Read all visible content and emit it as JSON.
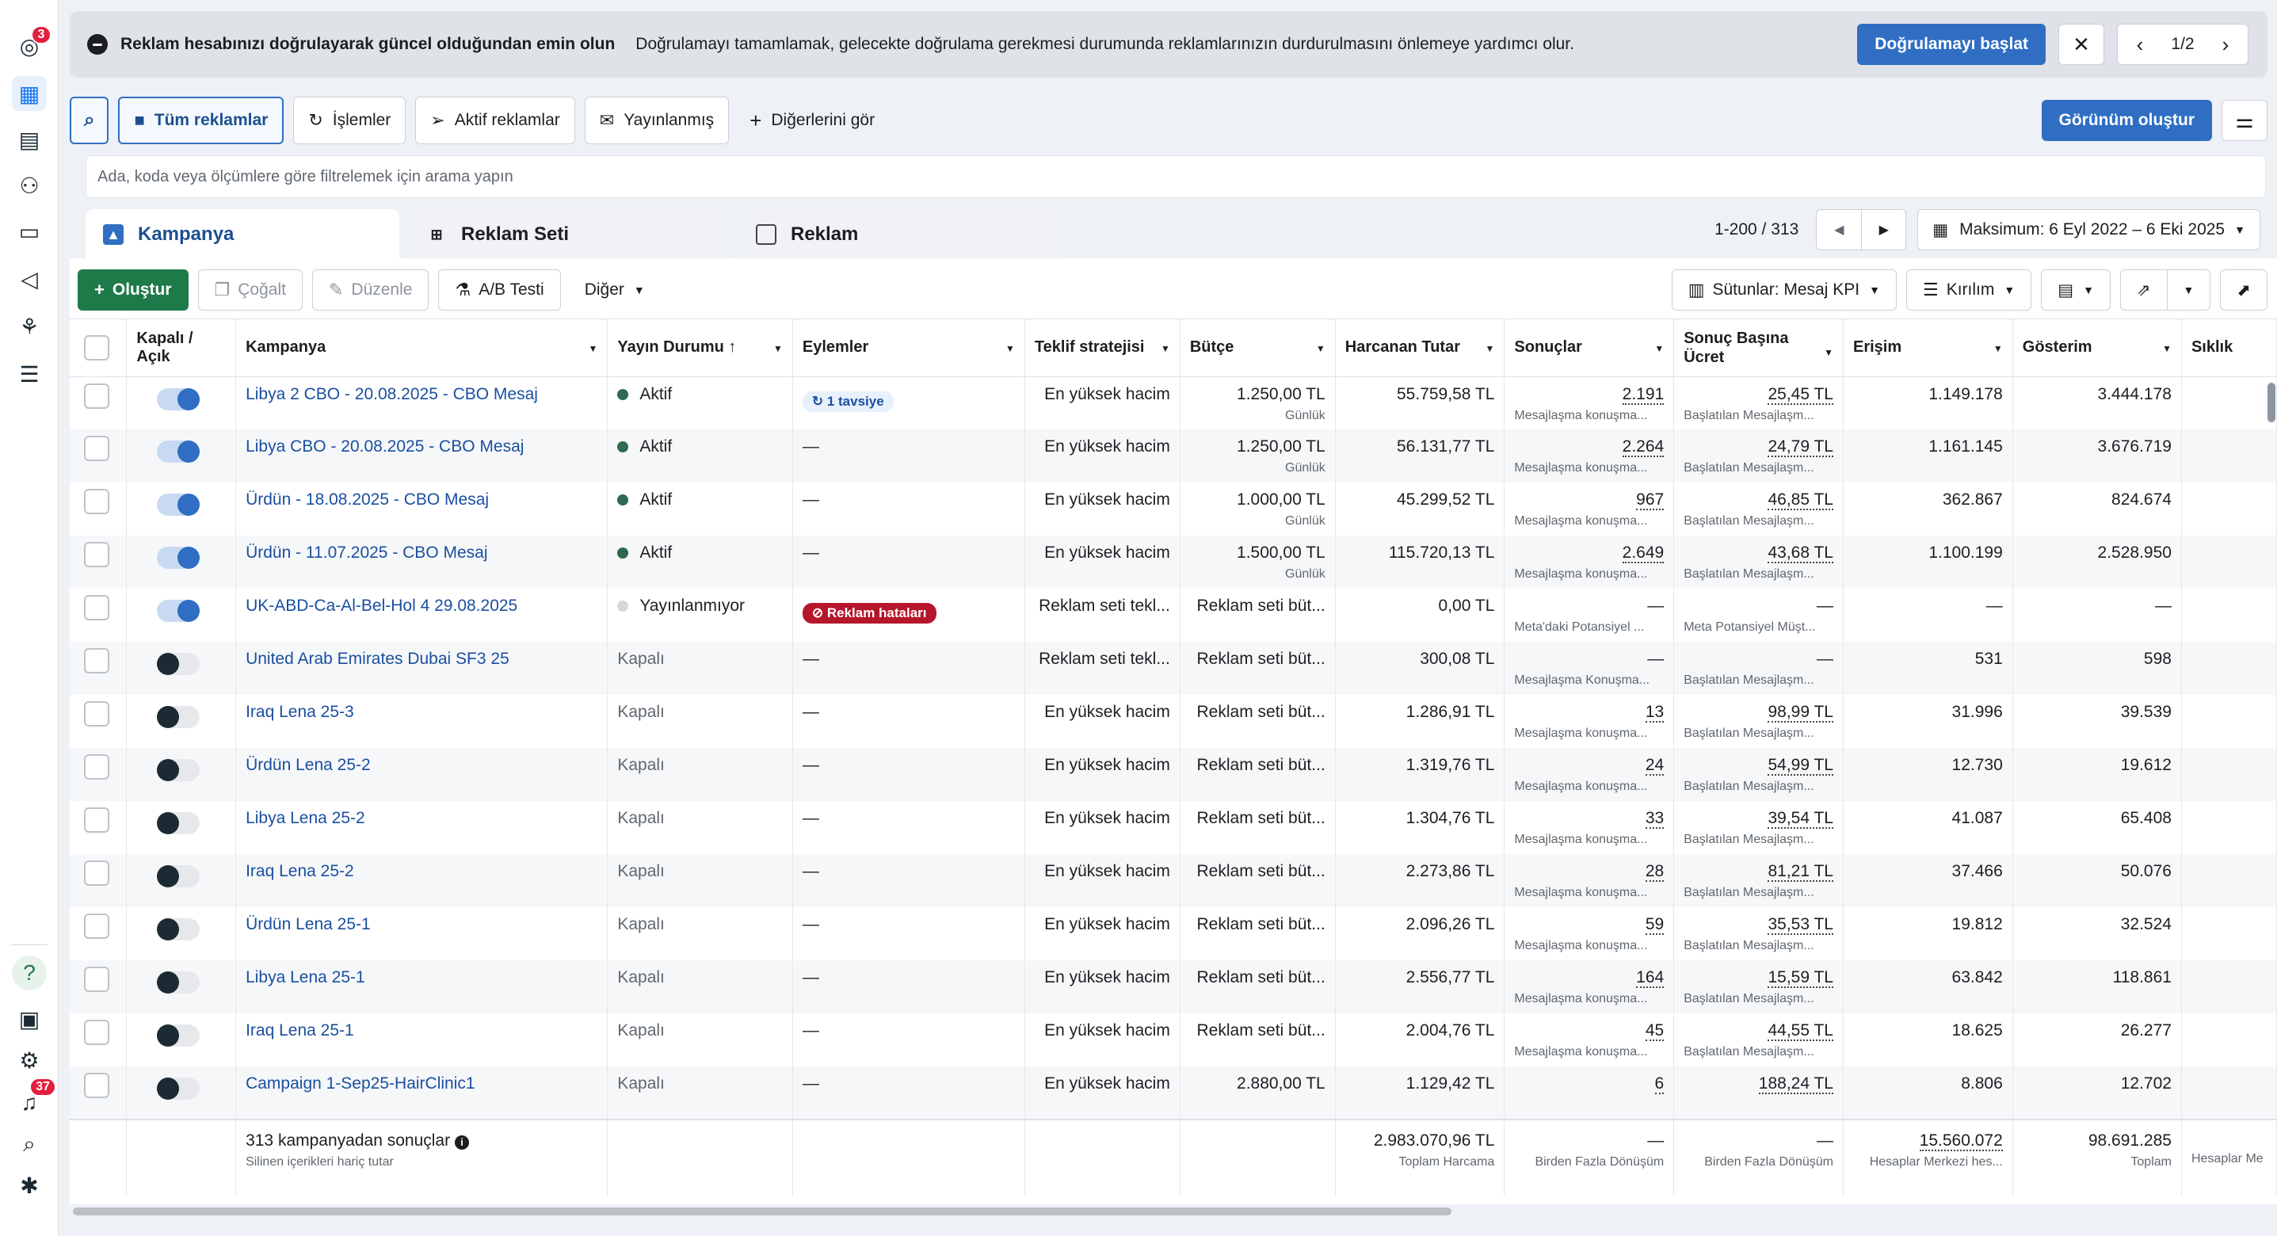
{
  "nav": {
    "top_badge": "3",
    "bottom_badge": "37",
    "items": [
      "account-icon",
      "campaigns-table-icon",
      "pages-icon",
      "audiences-icon",
      "billing-icon",
      "ads-megaphone-icon",
      "structure-icon",
      "menu-icon"
    ],
    "bottom_items": [
      "help-icon",
      "news-icon",
      "settings-icon",
      "notifications-icon",
      "search-icon",
      "bug-icon"
    ]
  },
  "banner": {
    "title": "Reklam hesabınızı doğrulayarak güncel olduğundan emin olun",
    "text": "Doğrulamayı tamamlamak, gelecekte doğrulama gerekmesi durumunda reklamlarınızın durdurulmasını önlemeye yardımcı olur.",
    "cta": "Doğrulamayı başlat",
    "pager": "1/2"
  },
  "toolbar1": {
    "all_ads": "Tüm reklamlar",
    "actions": "İşlemler",
    "active_ads": "Aktif reklamlar",
    "published": "Yayınlanmış",
    "see_others": "Diğerlerini gör",
    "create_view": "Görünüm oluştur"
  },
  "search": {
    "placeholder": "Ada, koda veya ölçümlere göre filtrelemek için arama yapın"
  },
  "tabs": {
    "campaign": "Kampanya",
    "adset": "Reklam Seti",
    "ad": "Reklam"
  },
  "range": {
    "text": "1-200 / 313",
    "date": "Maksimum: 6 Eyl 2022 – 6 Eki 2025"
  },
  "toolbar2": {
    "create": "Oluştur",
    "duplicate": "Çoğalt",
    "edit": "Düzenle",
    "ab_test": "A/B Testi",
    "more": "Diğer",
    "columns": "Sütunlar: Mesaj KPI",
    "breakdown": "Kırılım"
  },
  "columns": {
    "toggle": "Kapalı / Açık",
    "campaign": "Kampanya",
    "status": "Yayın Durumu ↑",
    "actions": "Eylemler",
    "bid": "Teklif stratejisi",
    "budget": "Bütçe",
    "spent": "Harcanan Tutar",
    "results": "Sonuçlar",
    "cpr": "Sonuç Başına Ücret",
    "reach": "Erişim",
    "impressions": "Gösterim",
    "frequency": "Sıklık"
  },
  "rows": [
    {
      "on": true,
      "name": "Libya 2 CBO - 20.08.2025 - CBO Mesaj",
      "status": "Aktif",
      "status_kind": "active",
      "action": "1 tavsiye",
      "action_kind": "rec",
      "bid": "En yüksek hacim",
      "budget": "1.250,00 TL",
      "budget_sub": "Günlük",
      "spent": "55.759,58 TL",
      "results": "2.191",
      "results_sub": "Mesajlaşma konuşma...",
      "cpr": "25,45 TL",
      "cpr_sub": "Başlatılan Mesajlaşm...",
      "reach": "1.149.178",
      "impr": "3.444.178"
    },
    {
      "on": true,
      "name": "Libya CBO - 20.08.2025 - CBO Mesaj",
      "status": "Aktif",
      "status_kind": "active",
      "action": "—",
      "action_kind": "none",
      "bid": "En yüksek hacim",
      "budget": "1.250,00 TL",
      "budget_sub": "Günlük",
      "spent": "56.131,77 TL",
      "results": "2.264",
      "results_sub": "Mesajlaşma konuşma...",
      "cpr": "24,79 TL",
      "cpr_sub": "Başlatılan Mesajlaşm...",
      "reach": "1.161.145",
      "impr": "3.676.719"
    },
    {
      "on": true,
      "name": "Ürdün - 18.08.2025 - CBO Mesaj",
      "status": "Aktif",
      "status_kind": "active",
      "action": "—",
      "action_kind": "none",
      "bid": "En yüksek hacim",
      "budget": "1.000,00 TL",
      "budget_sub": "Günlük",
      "spent": "45.299,52 TL",
      "results": "967",
      "results_sub": "Mesajlaşma konuşma...",
      "cpr": "46,85 TL",
      "cpr_sub": "Başlatılan Mesajlaşm...",
      "reach": "362.867",
      "impr": "824.674"
    },
    {
      "on": true,
      "name": "Ürdün - 11.07.2025 - CBO Mesaj",
      "status": "Aktif",
      "status_kind": "active",
      "action": "—",
      "action_kind": "none",
      "bid": "En yüksek hacim",
      "budget": "1.500,00 TL",
      "budget_sub": "Günlük",
      "spent": "115.720,13 TL",
      "results": "2.649",
      "results_sub": "Mesajlaşma konuşma...",
      "cpr": "43,68 TL",
      "cpr_sub": "Başlatılan Mesajlaşm...",
      "reach": "1.100.199",
      "impr": "2.528.950"
    },
    {
      "on": true,
      "name": "UK-ABD-Ca-Al-Bel-Hol 4 29.08.2025",
      "status": "Yayınlanmıyor",
      "status_kind": "notpub",
      "action": "Reklam hataları",
      "action_kind": "err",
      "bid": "Reklam seti tekl...",
      "budget": "Reklam seti büt...",
      "budget_sub": "",
      "spent": "0,00 TL",
      "results": "—",
      "results_sub": "Meta'daki Potansiyel ...",
      "cpr": "—",
      "cpr_sub": "Meta Potansiyel Müşt...",
      "reach": "—",
      "impr": "—"
    },
    {
      "on": false,
      "name": "United Arab Emirates Dubai SF3 25",
      "status": "Kapalı",
      "status_kind": "off",
      "action": "—",
      "action_kind": "none",
      "bid": "Reklam seti tekl...",
      "budget": "Reklam seti büt...",
      "budget_sub": "",
      "spent": "300,08 TL",
      "results": "—",
      "results_sub": "Mesajlaşma Konuşma...",
      "cpr": "—",
      "cpr_sub": "Başlatılan Mesajlaşm...",
      "reach": "531",
      "impr": "598"
    },
    {
      "on": false,
      "name": "Iraq Lena 25-3",
      "status": "Kapalı",
      "status_kind": "off",
      "action": "—",
      "action_kind": "none",
      "bid": "En yüksek hacim",
      "budget": "Reklam seti büt...",
      "budget_sub": "",
      "spent": "1.286,91 TL",
      "results": "13",
      "results_sub": "Mesajlaşma konuşma...",
      "cpr": "98,99 TL",
      "cpr_sub": "Başlatılan Mesajlaşm...",
      "reach": "31.996",
      "impr": "39.539"
    },
    {
      "on": false,
      "name": "Ürdün Lena 25-2",
      "status": "Kapalı",
      "status_kind": "off",
      "action": "—",
      "action_kind": "none",
      "bid": "En yüksek hacim",
      "budget": "Reklam seti büt...",
      "budget_sub": "",
      "spent": "1.319,76 TL",
      "results": "24",
      "results_sub": "Mesajlaşma konuşma...",
      "cpr": "54,99 TL",
      "cpr_sub": "Başlatılan Mesajlaşm...",
      "reach": "12.730",
      "impr": "19.612"
    },
    {
      "on": false,
      "name": "Libya Lena 25-2",
      "status": "Kapalı",
      "status_kind": "off",
      "action": "—",
      "action_kind": "none",
      "bid": "En yüksek hacim",
      "budget": "Reklam seti büt...",
      "budget_sub": "",
      "spent": "1.304,76 TL",
      "results": "33",
      "results_sub": "Mesajlaşma konuşma...",
      "cpr": "39,54 TL",
      "cpr_sub": "Başlatılan Mesajlaşm...",
      "reach": "41.087",
      "impr": "65.408"
    },
    {
      "on": false,
      "name": "Iraq Lena 25-2",
      "status": "Kapalı",
      "status_kind": "off",
      "action": "—",
      "action_kind": "none",
      "bid": "En yüksek hacim",
      "budget": "Reklam seti büt...",
      "budget_sub": "",
      "spent": "2.273,86 TL",
      "results": "28",
      "results_sub": "Mesajlaşma konuşma...",
      "cpr": "81,21 TL",
      "cpr_sub": "Başlatılan Mesajlaşm...",
      "reach": "37.466",
      "impr": "50.076"
    },
    {
      "on": false,
      "name": "Ürdün Lena 25-1",
      "status": "Kapalı",
      "status_kind": "off",
      "action": "—",
      "action_kind": "none",
      "bid": "En yüksek hacim",
      "budget": "Reklam seti büt...",
      "budget_sub": "",
      "spent": "2.096,26 TL",
      "results": "59",
      "results_sub": "Mesajlaşma konuşma...",
      "cpr": "35,53 TL",
      "cpr_sub": "Başlatılan Mesajlaşm...",
      "reach": "19.812",
      "impr": "32.524"
    },
    {
      "on": false,
      "name": "Libya Lena 25-1",
      "status": "Kapalı",
      "status_kind": "off",
      "action": "—",
      "action_kind": "none",
      "bid": "En yüksek hacim",
      "budget": "Reklam seti büt...",
      "budget_sub": "",
      "spent": "2.556,77 TL",
      "results": "164",
      "results_sub": "Mesajlaşma konuşma...",
      "cpr": "15,59 TL",
      "cpr_sub": "Başlatılan Mesajlaşm...",
      "reach": "63.842",
      "impr": "118.861"
    },
    {
      "on": false,
      "name": "Iraq Lena 25-1",
      "status": "Kapalı",
      "status_kind": "off",
      "action": "—",
      "action_kind": "none",
      "bid": "En yüksek hacim",
      "budget": "Reklam seti büt...",
      "budget_sub": "",
      "spent": "2.004,76 TL",
      "results": "45",
      "results_sub": "Mesajlaşma konuşma...",
      "cpr": "44,55 TL",
      "cpr_sub": "Başlatılan Mesajlaşm...",
      "reach": "18.625",
      "impr": "26.277"
    },
    {
      "on": false,
      "name": "Campaign 1-Sep25-HairClinic1",
      "status": "Kapalı",
      "status_kind": "off",
      "action": "—",
      "action_kind": "none",
      "bid": "En yüksek hacim",
      "budget": "2.880,00 TL",
      "budget_sub": "",
      "spent": "1.129,42 TL",
      "results": "6",
      "results_sub": "",
      "cpr": "188,24 TL",
      "cpr_sub": "",
      "reach": "8.806",
      "impr": "12.702"
    }
  ],
  "footer": {
    "title": "313 kampanyadan sonuçlar",
    "subtitle": "Silinen içerikleri hariç tutar",
    "spent": "2.983.070,96 TL",
    "spent_sub": "Toplam Harcama",
    "results": "—",
    "results_sub": "Birden Fazla Dönüşüm",
    "cpr": "—",
    "cpr_sub": "Birden Fazla Dönüşüm",
    "reach": "15.560.072",
    "reach_sub": "Hesaplar Merkezi hes...",
    "impr": "98.691.285",
    "impr_sub": "Toplam",
    "freq_sub": "Hesaplar Me"
  }
}
